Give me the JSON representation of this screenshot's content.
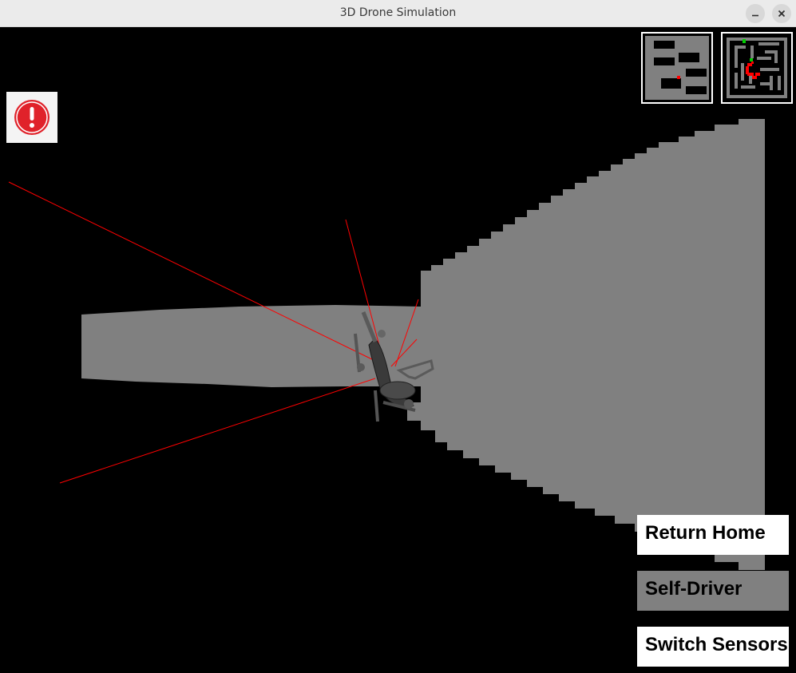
{
  "window": {
    "title": "3D Drone Simulation",
    "controls": [
      "minimize-icon",
      "close-icon"
    ]
  },
  "colors": {
    "floor": "#808080",
    "background": "#000000",
    "sensor_ray": "#ff0000",
    "alert_icon": "#e0222a",
    "map_start_marker": "#00cc00",
    "map_path": "#ff0000"
  },
  "alert": {
    "icon": "exclamation-circle-icon"
  },
  "minimaps": [
    {
      "name": "local-obstacle-map"
    },
    {
      "name": "maze-overview-map"
    }
  ],
  "buttons": {
    "return_home": "Return Home",
    "self_driver": "Self-Driver",
    "switch_sensors": "Switch Sensors"
  }
}
